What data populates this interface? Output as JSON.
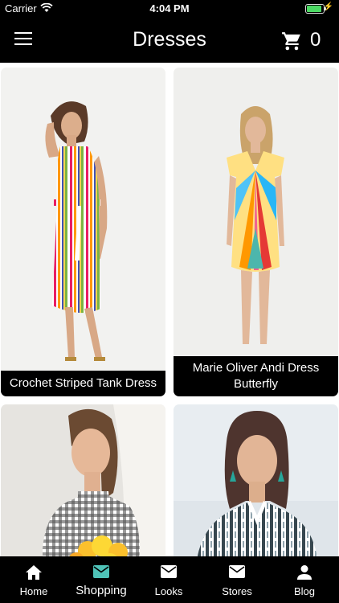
{
  "status_bar": {
    "carrier": "Carrier",
    "time": "4:04 PM"
  },
  "header": {
    "title": "Dresses",
    "cart_count": "0"
  },
  "products": [
    {
      "name": "Crochet Striped Tank Dress"
    },
    {
      "name": "Marie Oliver Andi Dress Butterfly"
    },
    {
      "name": ""
    },
    {
      "name": ""
    }
  ],
  "tabs": [
    {
      "label": "Home",
      "icon": "home-icon"
    },
    {
      "label": "Shopping",
      "icon": "mail-icon",
      "active": true,
      "accent": "#4fc3b8"
    },
    {
      "label": "Looks",
      "icon": "mail-icon"
    },
    {
      "label": "Stores",
      "icon": "mail-icon"
    },
    {
      "label": "Blog",
      "icon": "person-icon"
    }
  ]
}
